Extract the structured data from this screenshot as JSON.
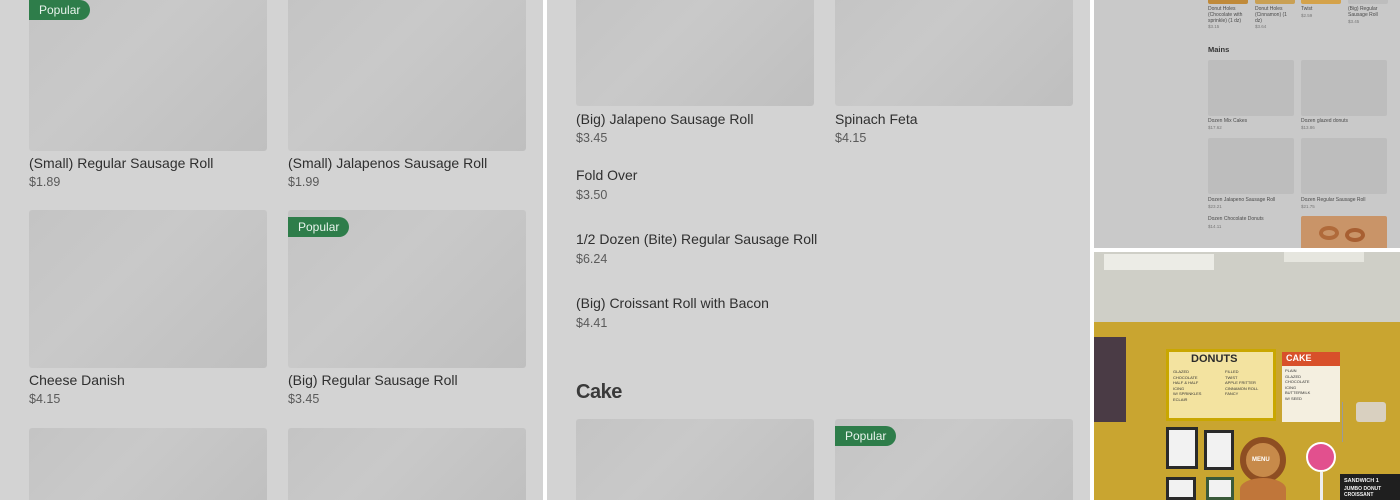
{
  "left_panel": {
    "items": [
      {
        "name": "(Small) Regular Sausage Roll",
        "price": "$1.89",
        "badge": "Popular"
      },
      {
        "name": "(Small) Jalapenos Sausage Roll",
        "price": "$1.99",
        "badge": ""
      },
      {
        "name": "Cheese Danish",
        "price": "$4.15",
        "badge": ""
      },
      {
        "name": "(Big) Regular Sausage Roll",
        "price": "$3.45",
        "badge": "Popular"
      }
    ]
  },
  "mid_panel": {
    "grid_items": [
      {
        "name": "(Big) Jalapeno Sausage Roll",
        "price": "$3.45"
      },
      {
        "name": "Spinach Feta",
        "price": "$4.15"
      }
    ],
    "list_items": [
      {
        "name": "Fold Over",
        "price": "$3.50"
      },
      {
        "name": "1/2 Dozen (Bite) Regular Sausage Roll",
        "price": "$6.24"
      },
      {
        "name": "(Big) Croissant Roll with Bacon",
        "price": "$4.41"
      }
    ],
    "section_title": "Cake",
    "cake_badge": "Popular"
  },
  "right_top": {
    "top_items": [
      {
        "name": "Donut Holes (Chocolate with sprinkle) (1 dz)",
        "price": "$3.15"
      },
      {
        "name": "Donut Holes (Cinnamon) (1 dz)",
        "price": "$3.64"
      },
      {
        "name": "Twist",
        "price": "$2.59"
      },
      {
        "name": "(Big) Regular Sausage Roll",
        "price": "$3.45"
      }
    ],
    "section_title": "Mains",
    "mains": [
      {
        "name": "Dozen Mix Cakes",
        "price": "$17.62"
      },
      {
        "name": "Dozen glazed donuts",
        "price": "$13.86"
      },
      {
        "name": "Dozen Jalapeno Sausage Roll",
        "price": "$23.21"
      },
      {
        "name": "Dozen Regular Sausage Roll",
        "price": "$21.75"
      },
      {
        "name": "Dozen Chocolate Donuts",
        "price": "$14.11"
      }
    ]
  },
  "right_bottom": {
    "menu_title_donuts": "DONUTS",
    "menu_title_cake": "CAKE",
    "menu_rows_donuts": [
      "GLAZED",
      "CHOCOLATE",
      "HALF & HALF",
      "ICING",
      "W/ SPRINKLES",
      "ECLAIR"
    ],
    "menu_rows_filled": [
      "FILLED",
      "TWIST",
      "APPLE FRITTER",
      "CINNAMON ROLL",
      "",
      "FANCY"
    ],
    "menu_rows_cake": [
      "PLAIN",
      "GLAZED",
      "CHOCOLATE",
      "ICING",
      "BUTTERMILK",
      "W/ SEED"
    ],
    "sign_menu": "MENU",
    "sign_sandwich": "SANDWICH 1",
    "sign_jumbo": "JUMBO DONUT CROISSANT"
  }
}
